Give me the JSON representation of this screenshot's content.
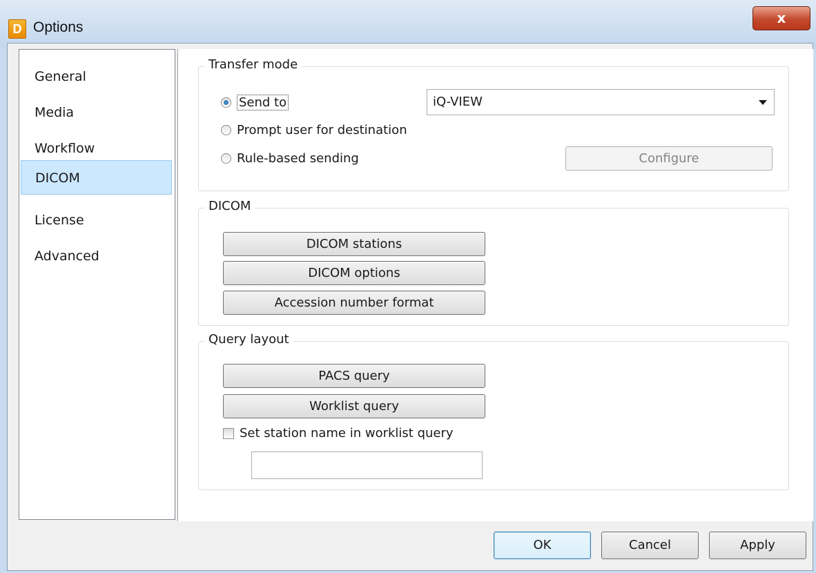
{
  "window": {
    "title": "Options",
    "app_icon_letter": "D",
    "close_glyph": "x"
  },
  "sidebar": {
    "items": [
      {
        "label": "General",
        "selected": false
      },
      {
        "label": "Media",
        "selected": false
      },
      {
        "label": "Workflow",
        "selected": false
      },
      {
        "label": "DICOM",
        "selected": true
      },
      {
        "label": "License",
        "selected": false
      },
      {
        "label": "Advanced",
        "selected": false
      }
    ]
  },
  "transfer_mode": {
    "group_label": "Transfer mode",
    "send_to_label": "Send to",
    "send_to_selected": true,
    "destination_value": "iQ-VIEW",
    "prompt_label": "Prompt user for destination",
    "rule_based_label": "Rule-based sending",
    "configure_label": "Configure"
  },
  "dicom": {
    "group_label": "DICOM",
    "stations_label": "DICOM stations",
    "options_label": "DICOM options",
    "accession_label": "Accession number format"
  },
  "query_layout": {
    "group_label": "Query layout",
    "pacs_label": "PACS query",
    "worklist_label": "Worklist query",
    "station_name_checkbox_label": "Set station name in worklist query",
    "station_name_checked": false,
    "station_name_value": ""
  },
  "footer": {
    "ok_label": "OK",
    "cancel_label": "Cancel",
    "apply_label": "Apply"
  },
  "colors": {
    "selection_bg": "#cce8ff",
    "close_button": "#c44a2e",
    "title_bar": "#c3d7ee"
  }
}
